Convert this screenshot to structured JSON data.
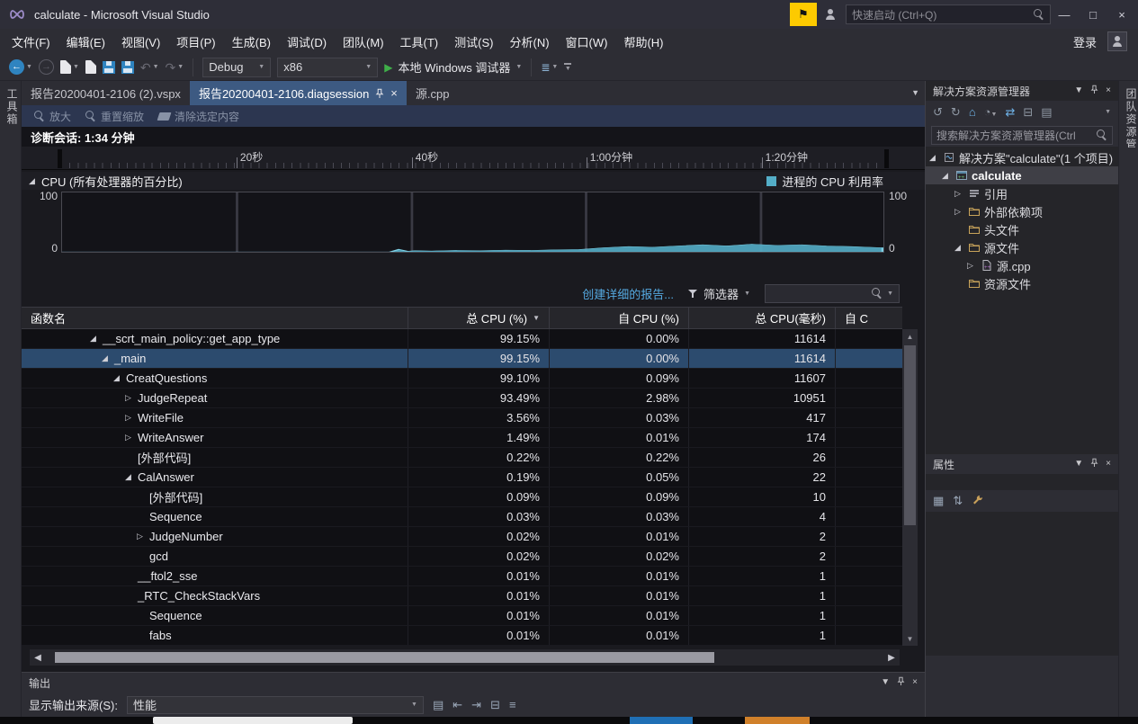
{
  "titlebar": {
    "title": "calculate - Microsoft Visual Studio",
    "quick_launch_placeholder": "快速启动 (Ctrl+Q)"
  },
  "menubar": {
    "items": [
      "文件(F)",
      "编辑(E)",
      "视图(V)",
      "项目(P)",
      "生成(B)",
      "调试(D)",
      "团队(M)",
      "工具(T)",
      "测试(S)",
      "分析(N)",
      "窗口(W)",
      "帮助(H)"
    ],
    "sign_in": "登录"
  },
  "toolbar": {
    "debug_config": "Debug",
    "platform": "x86",
    "run_label": "本地 Windows 调试器"
  },
  "doc_tabs": [
    {
      "label": "报告20200401-2106 (2).vspx",
      "active": false
    },
    {
      "label": "报告20200401-2106.diagsession",
      "active": true
    },
    {
      "label": "源.cpp",
      "active": false
    }
  ],
  "edge_tabs": {
    "left": "工具箱",
    "right": "团队资源管理器"
  },
  "diagnostics": {
    "zoom_in": "放大",
    "reset_zoom": "重置缩放",
    "clear_selection": "清除选定内容",
    "session_label": "诊断会话: 1:34 分钟",
    "ruler_ticks": [
      {
        "label": "20秒",
        "frac": 0.213
      },
      {
        "label": "40秒",
        "frac": 0.426
      },
      {
        "label": "1:00分钟",
        "frac": 0.638
      },
      {
        "label": "1:20分钟",
        "frac": 0.851
      }
    ],
    "cpu_section_title": "CPU (所有处理器的百分比)",
    "legend_label": "进程的 CPU 利用率",
    "axis_max": "100",
    "axis_min": "0",
    "report_link": "创建详细的报告...",
    "filter_label": "筛选器"
  },
  "chart_data": {
    "type": "area",
    "title": "CPU (所有处理器的百分比)",
    "legend": [
      "进程的 CPU 利用率"
    ],
    "legend_position": "top-right",
    "ylim": [
      0,
      100
    ],
    "x_ticks": [
      "20秒",
      "40秒",
      "1:00分钟",
      "1:20分钟"
    ],
    "total_duration": "1:34 分钟",
    "grid": true,
    "series": [
      {
        "name": "进程的 CPU 利用率",
        "color": "#54aec8",
        "x_frac": [
          0,
          0.4,
          0.41,
          0.42,
          0.43,
          0.45,
          0.48,
          0.51,
          0.54,
          0.57,
          0.6,
          0.63,
          0.66,
          0.69,
          0.72,
          0.75,
          0.78,
          0.81,
          0.84,
          0.87,
          0.9,
          0.93,
          0.96,
          0.98,
          1.0
        ],
        "y_pct": [
          0,
          0,
          4,
          1,
          2,
          1.5,
          2.5,
          2,
          3,
          2.5,
          3.5,
          4,
          7,
          9,
          8,
          10,
          12,
          10,
          13,
          11,
          12,
          10,
          9,
          8,
          7
        ]
      }
    ]
  },
  "call_table": {
    "columns": [
      {
        "label": "函数名",
        "align": "left"
      },
      {
        "label": "总 CPU (%)",
        "align": "right",
        "sort": "desc"
      },
      {
        "label": "自 CPU (%)",
        "align": "right"
      },
      {
        "label": "总 CPU(毫秒)",
        "align": "right"
      },
      {
        "label": "自 C",
        "align": "left"
      }
    ],
    "rows": [
      {
        "name": "__scrt_main_policy::get_app_type",
        "indent": 0,
        "expand": "expanded",
        "total_cpu_pct": "99.15%",
        "self_cpu_pct": "0.00%",
        "total_cpu_ms": "11614",
        "selected": false
      },
      {
        "name": "_main",
        "indent": 1,
        "expand": "expanded",
        "total_cpu_pct": "99.15%",
        "self_cpu_pct": "0.00%",
        "total_cpu_ms": "11614",
        "selected": true
      },
      {
        "name": "CreatQuestions",
        "indent": 2,
        "expand": "expanded",
        "total_cpu_pct": "99.10%",
        "self_cpu_pct": "0.09%",
        "total_cpu_ms": "11607",
        "selected": false
      },
      {
        "name": "JudgeRepeat",
        "indent": 3,
        "expand": "collapsed",
        "total_cpu_pct": "93.49%",
        "self_cpu_pct": "2.98%",
        "total_cpu_ms": "10951",
        "selected": false
      },
      {
        "name": "WriteFile",
        "indent": 3,
        "expand": "collapsed",
        "total_cpu_pct": "3.56%",
        "self_cpu_pct": "0.03%",
        "total_cpu_ms": "417",
        "selected": false
      },
      {
        "name": "WriteAnswer",
        "indent": 3,
        "expand": "collapsed",
        "total_cpu_pct": "1.49%",
        "self_cpu_pct": "0.01%",
        "total_cpu_ms": "174",
        "selected": false
      },
      {
        "name": "[外部代码]",
        "indent": 3,
        "expand": "none",
        "total_cpu_pct": "0.22%",
        "self_cpu_pct": "0.22%",
        "total_cpu_ms": "26",
        "selected": false
      },
      {
        "name": "CalAnswer",
        "indent": 3,
        "expand": "expanded",
        "total_cpu_pct": "0.19%",
        "self_cpu_pct": "0.05%",
        "total_cpu_ms": "22",
        "selected": false
      },
      {
        "name": "[外部代码]",
        "indent": 4,
        "expand": "none",
        "total_cpu_pct": "0.09%",
        "self_cpu_pct": "0.09%",
        "total_cpu_ms": "10",
        "selected": false
      },
      {
        "name": "Sequence",
        "indent": 4,
        "expand": "none",
        "total_cpu_pct": "0.03%",
        "self_cpu_pct": "0.03%",
        "total_cpu_ms": "4",
        "selected": false
      },
      {
        "name": "JudgeNumber",
        "indent": 4,
        "expand": "collapsed",
        "total_cpu_pct": "0.02%",
        "self_cpu_pct": "0.01%",
        "total_cpu_ms": "2",
        "selected": false
      },
      {
        "name": "gcd",
        "indent": 4,
        "expand": "none",
        "total_cpu_pct": "0.02%",
        "self_cpu_pct": "0.02%",
        "total_cpu_ms": "2",
        "selected": false
      },
      {
        "name": "__ftol2_sse",
        "indent": 3,
        "expand": "none",
        "total_cpu_pct": "0.01%",
        "self_cpu_pct": "0.01%",
        "total_cpu_ms": "1",
        "selected": false
      },
      {
        "name": "_RTC_CheckStackVars",
        "indent": 3,
        "expand": "none",
        "total_cpu_pct": "0.01%",
        "self_cpu_pct": "0.01%",
        "total_cpu_ms": "1",
        "selected": false
      },
      {
        "name": "Sequence",
        "indent": 4,
        "expand": "none",
        "total_cpu_pct": "0.01%",
        "self_cpu_pct": "0.01%",
        "total_cpu_ms": "1",
        "selected": false
      },
      {
        "name": "fabs",
        "indent": 4,
        "expand": "none",
        "total_cpu_pct": "0.01%",
        "self_cpu_pct": "0.01%",
        "total_cpu_ms": "1",
        "selected": false
      }
    ]
  },
  "output_panel": {
    "title": "输出",
    "source_label": "显示输出来源(S):",
    "source_value": "性能"
  },
  "solution_explorer": {
    "title": "解决方案资源管理器",
    "search_placeholder": "搜索解决方案资源管理器(Ctrl",
    "tree": [
      {
        "label": "解决方案\"calculate\"(1 个项目)",
        "indent": 0,
        "expand": "expanded",
        "icon": "solution-icon",
        "bold": false,
        "selected": false
      },
      {
        "label": "calculate",
        "indent": 1,
        "expand": "expanded",
        "icon": "cpp-project-icon",
        "bold": true,
        "selected": true
      },
      {
        "label": "引用",
        "indent": 2,
        "expand": "collapsed",
        "icon": "references-icon",
        "bold": false,
        "selected": false
      },
      {
        "label": "外部依赖项",
        "indent": 2,
        "expand": "collapsed",
        "icon": "folder-icon",
        "bold": false,
        "selected": false
      },
      {
        "label": "头文件",
        "indent": 2,
        "expand": "none",
        "icon": "folder-icon",
        "bold": false,
        "selected": false
      },
      {
        "label": "源文件",
        "indent": 2,
        "expand": "expanded",
        "icon": "folder-icon",
        "bold": false,
        "selected": false
      },
      {
        "label": "源.cpp",
        "indent": 3,
        "expand": "collapsed",
        "icon": "cpp-file-icon",
        "bold": false,
        "selected": false
      },
      {
        "label": "资源文件",
        "indent": 2,
        "expand": "none",
        "icon": "folder-icon",
        "bold": false,
        "selected": false
      }
    ]
  },
  "properties_panel": {
    "title": "属性"
  },
  "colors": {
    "accent": "#007acc",
    "active_tab": "#3d5a82",
    "row_selection": "#2c4b6e",
    "chart_fill": "#54aec8",
    "link_blue": "#55a9e0",
    "flag_yellow": "#fdca00"
  }
}
